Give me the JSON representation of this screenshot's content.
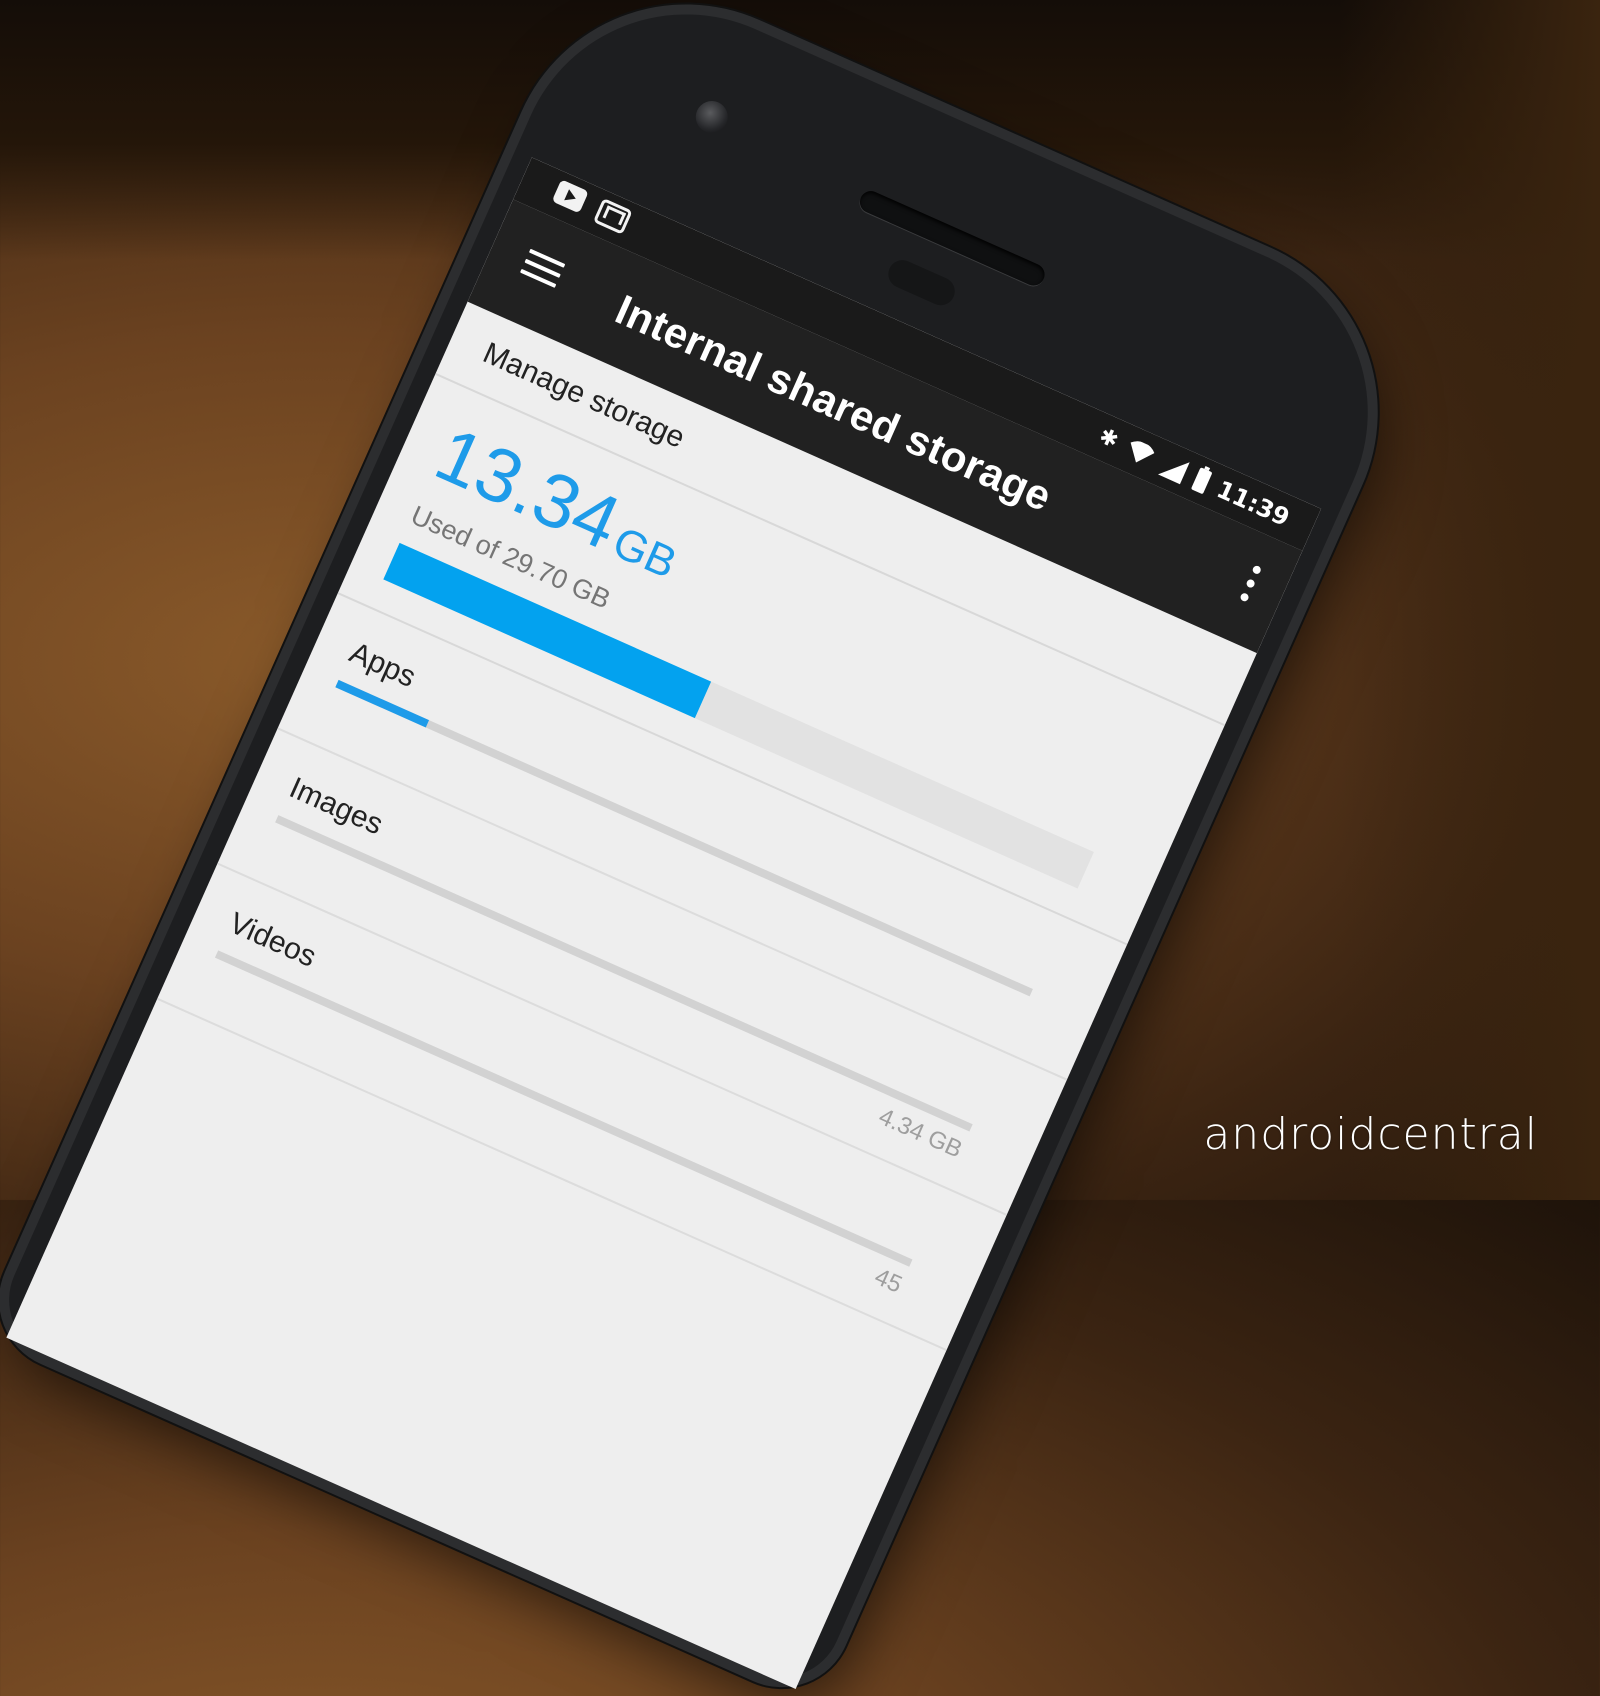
{
  "status_bar": {
    "notifications": [
      "youtube-icon",
      "gmail-icon"
    ],
    "icons": [
      "bluetooth-icon",
      "wifi-icon",
      "signal-icon",
      "battery-icon"
    ],
    "time": "11:39"
  },
  "app_bar": {
    "title": "Internal shared storage",
    "menu_icon": "hamburger-menu-icon",
    "overflow_icon": "more-vert-icon"
  },
  "manage": {
    "label": "Manage storage"
  },
  "summary": {
    "used_value": "13.34",
    "used_unit": "GB",
    "used_of": "Used of 29.70 GB",
    "used_fraction": 0.449,
    "accent": "#03a2ef"
  },
  "categories": [
    {
      "label": "Apps",
      "size": "",
      "fraction": 0.13
    },
    {
      "label": "Images",
      "size": "4.34 GB",
      "fraction": 0.0
    },
    {
      "label": "Videos",
      "size": "45",
      "fraction": 0.0
    }
  ],
  "watermark": "androidcentral"
}
